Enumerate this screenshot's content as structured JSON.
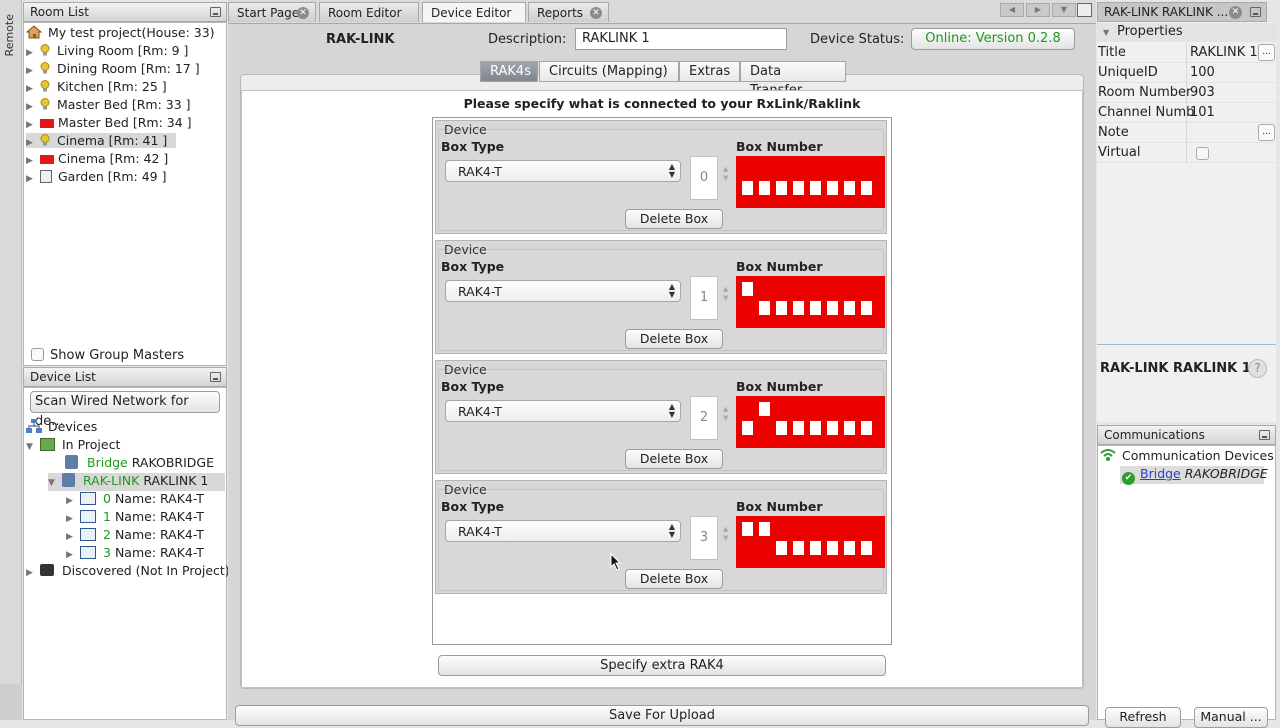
{
  "side_strip": {
    "label": "Remote"
  },
  "room_list": {
    "title": "Room List",
    "project": "My test project(House: 33)",
    "rooms": [
      {
        "label": "Living Room [Rm: 9 ]",
        "icon": "bulb"
      },
      {
        "label": "Dining Room [Rm: 17 ]",
        "icon": "bulb"
      },
      {
        "label": "Kitchen [Rm: 25 ]",
        "icon": "bulb"
      },
      {
        "label": "Master Bed [Rm: 33 ]",
        "icon": "bulb"
      },
      {
        "label": "Master Bed [Rm: 34 ]",
        "icon": "red-flag"
      },
      {
        "label": "Cinema  [Rm: 41 ]",
        "icon": "bulb"
      },
      {
        "label": "Cinema  [Rm: 42 ]",
        "icon": "red-flag"
      },
      {
        "label": "Garden [Rm: 49 ]",
        "icon": "switch"
      }
    ],
    "show_group_masters": "Show Group Masters"
  },
  "device_list": {
    "title": "Device List",
    "scan_button": "Scan Wired Network for de...",
    "devices": "Devices",
    "in_project": "In Project",
    "bridge_type": "Bridge",
    "bridge_name": "RAKOBRIDGE",
    "raklink_type": "RAK-LINK",
    "raklink_name": "RAKLINK 1",
    "children": [
      {
        "num": "0",
        "name": "Name: RAK4-T"
      },
      {
        "num": "1",
        "name": "Name: RAK4-T"
      },
      {
        "num": "2",
        "name": "Name: RAK4-T"
      },
      {
        "num": "3",
        "name": "Name: RAK4-T"
      }
    ],
    "discovered": "Discovered (Not In Project)"
  },
  "tabs": [
    "Start Page",
    "Room Editor",
    "Device Editor",
    "Reports"
  ],
  "editor": {
    "device_name": "RAK-LINK",
    "description_label": "Description:",
    "description_value": "RAKLINK 1",
    "status_label": "Device Status:",
    "status_value": "Online: Version 0.2.8",
    "subtabs": [
      "RAK4s",
      "Circuits (Mapping)",
      "Extras",
      "Data Transfer"
    ],
    "instruction": "Please specify what is connected to your RxLink/Raklink",
    "device_legend": "Device",
    "box_type_label": "Box Type",
    "box_number_label": "Box Number",
    "delete_label": "Delete Box",
    "boxes": [
      {
        "type": "RAK4-T",
        "number": "0",
        "switches_up": [
          false,
          false,
          false,
          false,
          false,
          false,
          false,
          false
        ]
      },
      {
        "type": "RAK4-T",
        "number": "1",
        "switches_up": [
          true,
          false,
          false,
          false,
          false,
          false,
          false,
          false
        ]
      },
      {
        "type": "RAK4-T",
        "number": "2",
        "switches_up": [
          false,
          true,
          false,
          false,
          false,
          false,
          false,
          false
        ]
      },
      {
        "type": "RAK4-T",
        "number": "3",
        "switches_up": [
          true,
          true,
          false,
          false,
          false,
          false,
          false,
          false
        ]
      }
    ],
    "extra_button": "Specify extra RAK4",
    "save_button": "Save For Upload"
  },
  "properties": {
    "tab_title": "RAK-LINK RAKLINK ...",
    "header": "Properties",
    "rows": [
      {
        "key": "Title",
        "value": "RAKLINK 1"
      },
      {
        "key": "UniqueID",
        "value": "100"
      },
      {
        "key": "Room Number",
        "value": "903"
      },
      {
        "key": "Channel Numb",
        "value": "101"
      },
      {
        "key": "Note",
        "value": ""
      },
      {
        "key": "Virtual",
        "value": ""
      }
    ],
    "ellipsis": "...",
    "footer_title": "RAK-LINK RAKLINK 1",
    "help": "?"
  },
  "communications": {
    "title": "Communications",
    "group": "Communication Devices",
    "bridge_type": "Bridge",
    "bridge_name": "RAKOBRIDGE",
    "refresh": "Refresh",
    "manual": "Manual ..."
  },
  "colors": {
    "accent_green": "#1e9a1e",
    "dip_red": "#ec0000"
  }
}
